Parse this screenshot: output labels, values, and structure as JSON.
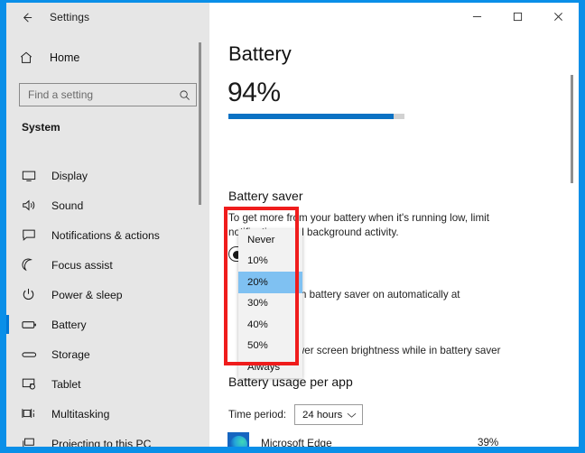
{
  "window": {
    "title": "Settings",
    "back_icon": "back-arrow-icon",
    "controls": {
      "minimize": "minimize-icon",
      "maximize": "maximize-icon",
      "close": "close-icon"
    }
  },
  "sidebar": {
    "home_label": "Home",
    "home_icon": "home-icon",
    "search": {
      "placeholder": "Find a setting",
      "value": "",
      "icon": "search-icon"
    },
    "group_title": "System",
    "items": [
      {
        "label": "Display",
        "icon": "monitor-icon",
        "selected": false
      },
      {
        "label": "Sound",
        "icon": "speaker-icon",
        "selected": false
      },
      {
        "label": "Notifications & actions",
        "icon": "notification-icon",
        "selected": false
      },
      {
        "label": "Focus assist",
        "icon": "moon-icon",
        "selected": false
      },
      {
        "label": "Power & sleep",
        "icon": "power-icon",
        "selected": false
      },
      {
        "label": "Battery",
        "icon": "battery-icon",
        "selected": true
      },
      {
        "label": "Storage",
        "icon": "storage-icon",
        "selected": false
      },
      {
        "label": "Tablet",
        "icon": "tablet-icon",
        "selected": false
      },
      {
        "label": "Multitasking",
        "icon": "multitasking-icon",
        "selected": false
      },
      {
        "label": "Projecting to this PC",
        "icon": "projecting-icon",
        "selected": false
      }
    ]
  },
  "main": {
    "page_title": "Battery",
    "battery_percent_text": "94%",
    "battery_percent_value": 94,
    "battery_saver": {
      "heading": "Battery saver",
      "description": "To get more from your battery when it's running low, limit notifications and background activity.",
      "toggle_state": "Off",
      "auto_on_label": "Turn battery saver on automatically at",
      "brightness_label": "Lower screen brightness while in battery saver"
    },
    "dropdown": {
      "selected": "20%",
      "options": [
        "Never",
        "10%",
        "20%",
        "30%",
        "40%",
        "50%",
        "Always"
      ],
      "highlight_color": "#ef1c1c"
    },
    "usage": {
      "heading": "Battery usage per app",
      "time_period_label": "Time period:",
      "time_period_value": "24 hours",
      "chevron_icon": "chevron-down-icon",
      "apps": [
        {
          "name": "Microsoft Edge",
          "percent": "39%",
          "icon": "microsoft-edge-icon"
        }
      ]
    }
  },
  "colors": {
    "frame_blue": "#0a8fe8",
    "accent_blue": "#0078d7",
    "progress_blue": "#0b72c4",
    "highlight_blue": "#7fc1f2",
    "red_annotation": "#ef1c1c"
  }
}
